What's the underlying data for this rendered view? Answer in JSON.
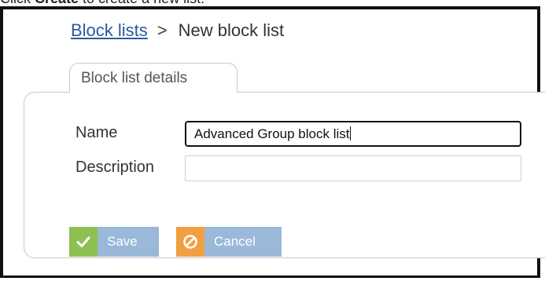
{
  "caption": {
    "prefix": "Click ",
    "strong": "Create",
    "suffix": " to create a new list."
  },
  "breadcrumb": {
    "link_label": "Block lists",
    "separator": ">",
    "current": "New block list"
  },
  "tab": {
    "label": "Block list details"
  },
  "form": {
    "name_label": "Name",
    "name_value": "Advanced Group block list",
    "description_label": "Description",
    "description_value": ""
  },
  "buttons": {
    "save_label": "Save",
    "cancel_label": "Cancel"
  },
  "icons": {
    "save": "check-icon",
    "cancel": "prohibited-icon"
  },
  "colors": {
    "link": "#2a5a9a",
    "button": "#9ab8d8",
    "save_icon_bg": "#8cc152",
    "cancel_icon_bg": "#f0a040"
  }
}
